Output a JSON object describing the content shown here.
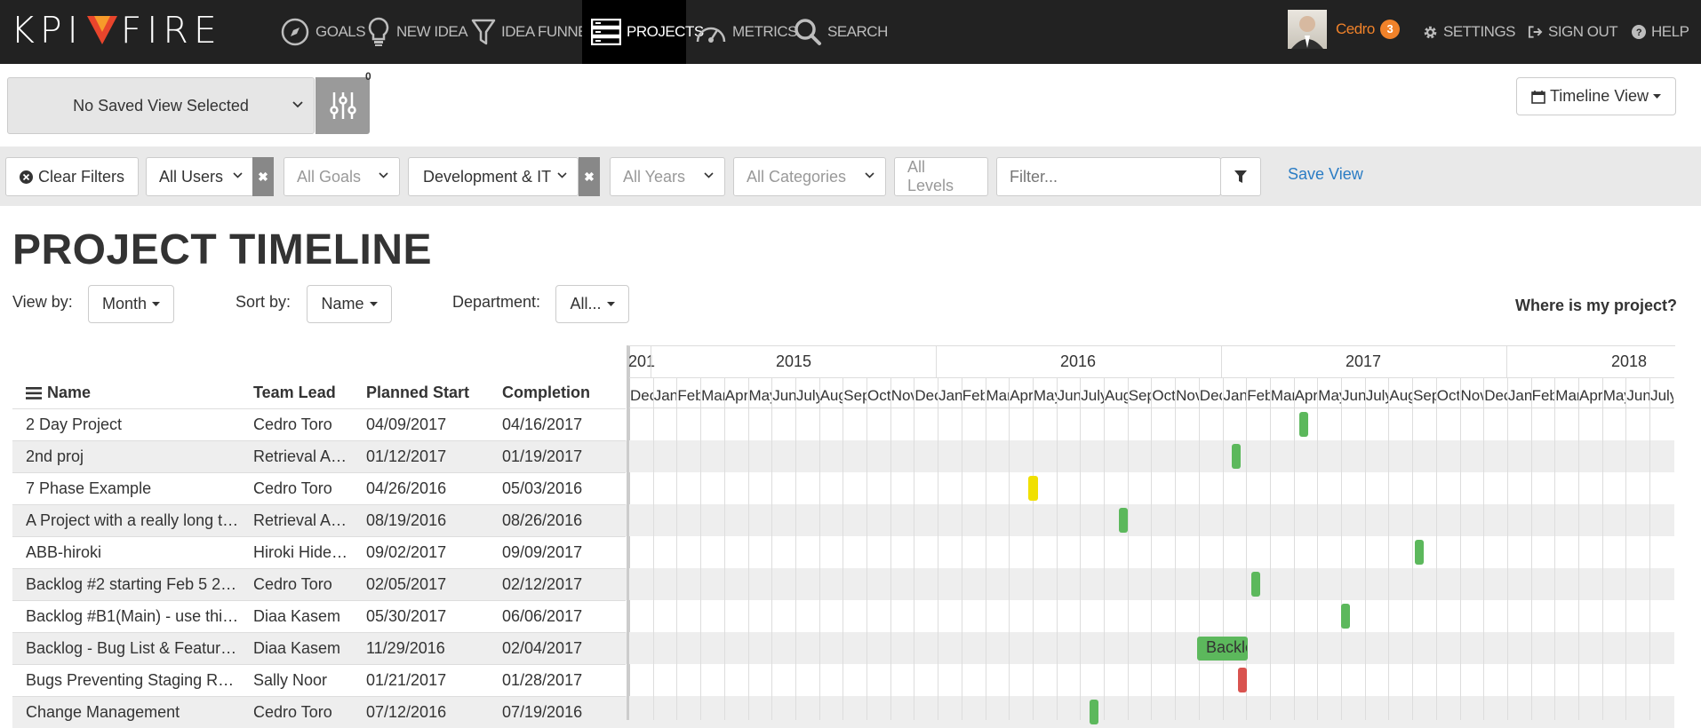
{
  "nav": {
    "logo_text_left": "KPI",
    "logo_text_right": "FIRE",
    "items": [
      {
        "label": "GOALS",
        "icon": "compass-icon"
      },
      {
        "label": "NEW IDEA",
        "icon": "lightbulb-icon"
      },
      {
        "label": "IDEA FUNNEL",
        "icon": "funnel-icon"
      },
      {
        "label": "PROJECTS",
        "icon": "server-icon",
        "active": true
      },
      {
        "label": "METRICS",
        "icon": "gauge-icon"
      },
      {
        "label": "SEARCH",
        "icon": "search-icon"
      }
    ],
    "user": {
      "name": "Cedro",
      "notifications": "3"
    },
    "settings": "SETTINGS",
    "sign_out": "SIGN OUT",
    "help": "HELP"
  },
  "view": {
    "saved_view": "No Saved View Selected",
    "filter_count": "0",
    "timeline_view": "Timeline View"
  },
  "filters": {
    "clear": "Clear Filters",
    "users": "All Users",
    "goals": "All Goals",
    "department": "Development & IT",
    "years": "All Years",
    "categories": "All Categories",
    "levels": "All Levels",
    "filter_placeholder": "Filter...",
    "save_view": "Save View"
  },
  "page": {
    "title": "PROJECT TIMELINE",
    "view_by_label": "View by:",
    "view_by_value": "Month",
    "sort_by_label": "Sort by:",
    "sort_by_value": "Name",
    "department_label": "Department:",
    "department_value": "All...",
    "where_link": "Where is my project?"
  },
  "table": {
    "headers": {
      "name": "Name",
      "lead": "Team Lead",
      "start": "Planned Start",
      "completion": "Completion"
    },
    "rows": [
      {
        "name": "2 Day Project",
        "lead": "Cedro Toro",
        "start": "04/09/2017",
        "completion": "04/16/2017"
      },
      {
        "name": "2nd proj",
        "lead": "Retrieval A…",
        "start": "01/12/2017",
        "completion": "01/19/2017"
      },
      {
        "name": "7 Phase Example",
        "lead": "Cedro Toro",
        "start": "04/26/2016",
        "completion": "05/03/2016"
      },
      {
        "name": "A Project with a really long t…",
        "lead": "Retrieval A…",
        "start": "08/19/2016",
        "completion": "08/26/2016"
      },
      {
        "name": "ABB-hiroki",
        "lead": "Hiroki Hide…",
        "start": "09/02/2017",
        "completion": "09/09/2017"
      },
      {
        "name": "Backlog #2 starting Feb 5 2…",
        "lead": "Cedro Toro",
        "start": "02/05/2017",
        "completion": "02/12/2017"
      },
      {
        "name": "Backlog #B1(Main) - use thi…",
        "lead": "Diaa Kasem",
        "start": "05/30/2017",
        "completion": "06/06/2017"
      },
      {
        "name": "Backlog - Bug List & Featur…",
        "lead": "Diaa Kasem",
        "start": "11/29/2016",
        "completion": "02/04/2017"
      },
      {
        "name": "Bugs Preventing Staging R…",
        "lead": "Sally Noor",
        "start": "01/21/2017",
        "completion": "01/28/2017"
      },
      {
        "name": "Change Management",
        "lead": "Cedro Toro",
        "start": "07/12/2016",
        "completion": "07/19/2016"
      }
    ]
  },
  "gantt": {
    "first_year_stub": "201",
    "years": [
      "2015",
      "2016",
      "2017",
      "2018"
    ],
    "months": [
      "Dec",
      "Jan",
      "Feb",
      "Mar",
      "Apr",
      "May",
      "Jun",
      "July",
      "Aug",
      "Sep",
      "Oct",
      "Nov",
      "Dec",
      "Jan",
      "Feb",
      "Mar",
      "Apr",
      "May",
      "Jun",
      "July",
      "Aug",
      "Sep",
      "Oct",
      "Nov",
      "Dec",
      "Jan",
      "Feb",
      "Mar",
      "Apr",
      "May",
      "Jun",
      "July",
      "Aug",
      "Sep",
      "Oct",
      "Nov",
      "Dec",
      "Jan",
      "Feb",
      "Mar",
      "Apr",
      "May",
      "Jun",
      "July"
    ],
    "bars": [
      {
        "row": 0,
        "color": "#5cb85c"
      },
      {
        "row": 1,
        "color": "#5cb85c"
      },
      {
        "row": 2,
        "color": "#f0e000"
      },
      {
        "row": 3,
        "color": "#5cb85c"
      },
      {
        "row": 4,
        "color": "#5cb85c"
      },
      {
        "row": 5,
        "color": "#5cb85c"
      },
      {
        "row": 6,
        "color": "#5cb85c"
      },
      {
        "row": 7,
        "color": "#5cb85c",
        "label": "Backlo"
      },
      {
        "row": 8,
        "color": "#d9534f"
      },
      {
        "row": 9,
        "color": "#5cb85c"
      }
    ]
  }
}
